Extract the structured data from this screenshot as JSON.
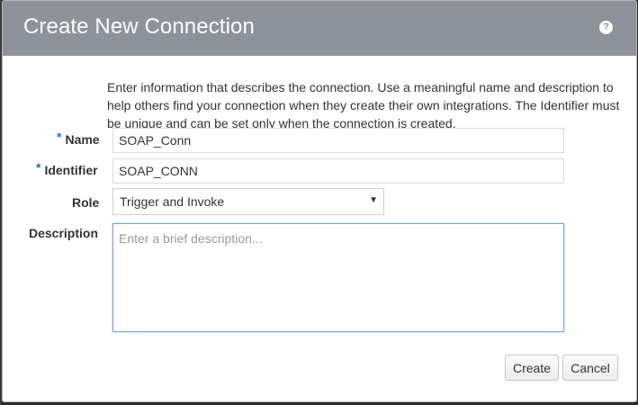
{
  "dialog": {
    "title": "Create New Connection",
    "help_icon": "?",
    "intro": "Enter information that describes the connection. Use a meaningful name and description to help others find your connection when they create their own integrations. The Identifier must be unique and can be set only when the connection is created."
  },
  "form": {
    "required_marker": "*",
    "name_label": "Name",
    "name_value": "SOAP_Conn",
    "identifier_label": "Identifier",
    "identifier_value": "SOAP_CONN",
    "role_label": "Role",
    "role_value": "Trigger and Invoke",
    "role_arrow": "▼",
    "description_label": "Description",
    "description_placeholder": "Enter a brief description..."
  },
  "buttons": {
    "create": "Create",
    "cancel": "Cancel"
  },
  "colors": {
    "titlebar": "#8e939b",
    "required": "#1e73c4",
    "focus_border": "#7aa6d8"
  }
}
